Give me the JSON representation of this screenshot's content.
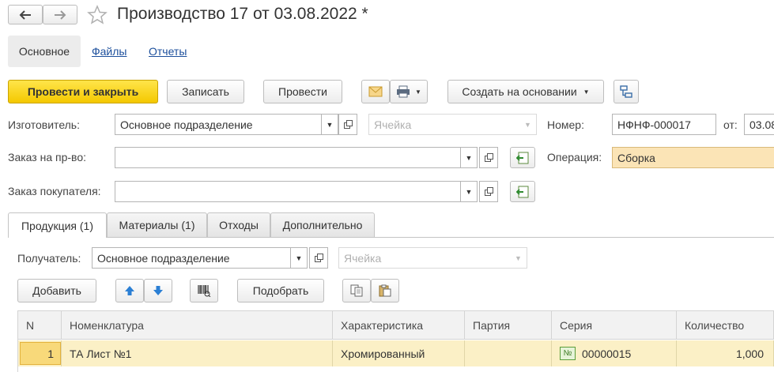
{
  "header": {
    "title": "Производство 17 от 03.08.2022 *"
  },
  "nav_tabs": [
    {
      "label": "Основное"
    },
    {
      "label": "Файлы"
    },
    {
      "label": "Отчеты"
    }
  ],
  "toolbar": {
    "post_close_label": "Провести и закрыть",
    "save_label": "Записать",
    "post_label": "Провести",
    "create_based_label": "Создать на основании"
  },
  "form": {
    "manufacturer_label": "Изготовитель:",
    "manufacturer_value": "Основное подразделение",
    "cell_placeholder": "Ячейка",
    "number_label": "Номер:",
    "number_value": "НФНФ-000017",
    "date_label": "от:",
    "date_value": "03.08",
    "order_label": "Заказ на пр-во:",
    "order_value": "",
    "operation_label": "Операция:",
    "operation_value": "Сборка",
    "customer_order_label": "Заказ покупателя:",
    "customer_order_value": ""
  },
  "inner_tabs": [
    {
      "label": "Продукция (1)"
    },
    {
      "label": "Материалы (1)"
    },
    {
      "label": "Отходы"
    },
    {
      "label": "Дополнительно"
    }
  ],
  "products": {
    "recipient_label": "Получатель:",
    "recipient_value": "Основное подразделение",
    "cell_placeholder": "Ячейка",
    "add_label": "Добавить",
    "pick_label": "Подобрать",
    "columns": [
      "N",
      "Номенклатура",
      "Характеристика",
      "Партия",
      "Серия",
      "Количество"
    ],
    "rows": [
      {
        "n": "1",
        "nomenclature": "ТА Лист №1",
        "characteristic": "Хромированный",
        "batch": "",
        "series": "00000015",
        "series_badge": "№",
        "quantity": "1,000"
      }
    ]
  },
  "icons": {
    "back": "arrow-left-icon",
    "forward": "arrow-right-icon",
    "favorite": "star-icon",
    "email": "envelope-icon",
    "print": "printer-icon",
    "structure": "structure-icon",
    "open": "open-form-icon",
    "fill": "fill-from-icon",
    "up": "arrow-up-icon",
    "down": "arrow-down-icon",
    "barcode": "barcode-icon",
    "copy": "copy-icon",
    "paste": "paste-icon"
  },
  "colors": {
    "primary_button": "#f4c800",
    "highlight_field": "#fbe4b6",
    "selected_row": "#fbf0c6",
    "link": "#1c4f9c",
    "arrow_blue": "#2b7fd4",
    "series_badge": "#5a9e3a"
  }
}
